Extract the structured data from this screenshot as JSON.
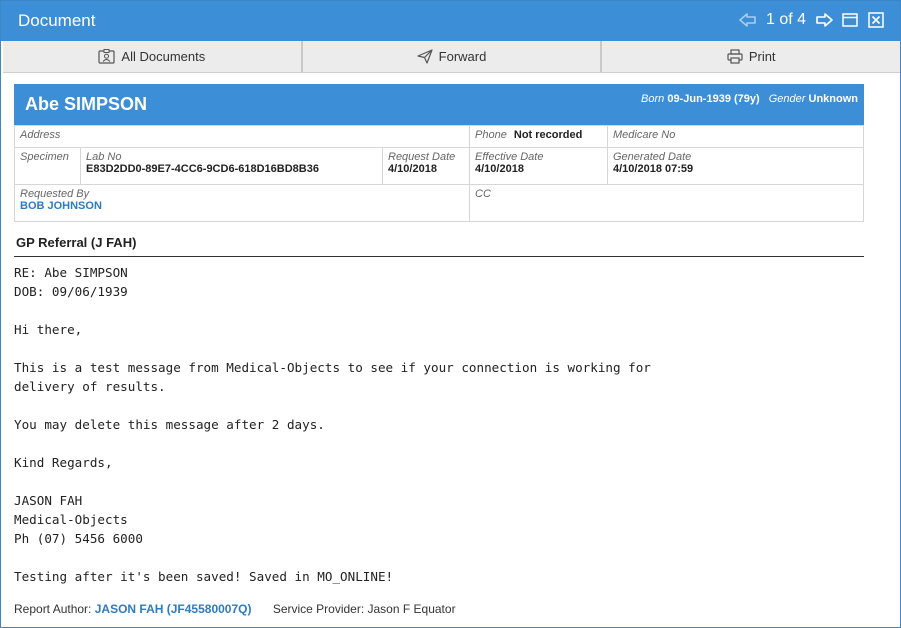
{
  "window": {
    "title": "Document",
    "page_indicator": "1 of 4"
  },
  "toolbar": {
    "all_documents": "All Documents",
    "forward": "Forward",
    "print": "Print"
  },
  "patient": {
    "name": "Abe SIMPSON",
    "born_label": "Born",
    "born_value": "09-Jun-1939 (79y)",
    "gender_label": "Gender",
    "gender_value": "Unknown"
  },
  "info": {
    "address_label": "Address",
    "phone_label": "Phone",
    "phone_value": "Not recorded",
    "medicare_label": "Medicare No",
    "specimen_label": "Specimen",
    "labno_label": "Lab No",
    "labno_value": "E83D2DD0-89E7-4CC6-9CD6-618D16BD8B36",
    "request_date_label": "Request Date",
    "request_date_value": "4/10/2018",
    "effective_date_label": "Effective Date",
    "effective_date_value": "4/10/2018",
    "generated_date_label": "Generated Date",
    "generated_date_value": "4/10/2018 07:59",
    "requested_by_label": "Requested By",
    "requested_by_value": "BOB JOHNSON",
    "cc_label": "CC"
  },
  "document": {
    "section_title": "GP Referral (J FAH)",
    "body": "RE: Abe SIMPSON\nDOB: 09/06/1939\n\nHi there,\n\nThis is a test message from Medical-Objects to see if your connection is working for\ndelivery of results.\n\nYou may delete this message after 2 days.\n\nKind Regards,\n\nJASON FAH\nMedical-Objects\nPh (07) 5456 6000\n\nTesting after it's been saved! Saved in MO_ONLINE!"
  },
  "footer": {
    "author_label": "Report Author:",
    "author_value": "JASON FAH (JF45580007Q)",
    "provider": "Service Provider: Jason F Equator"
  }
}
